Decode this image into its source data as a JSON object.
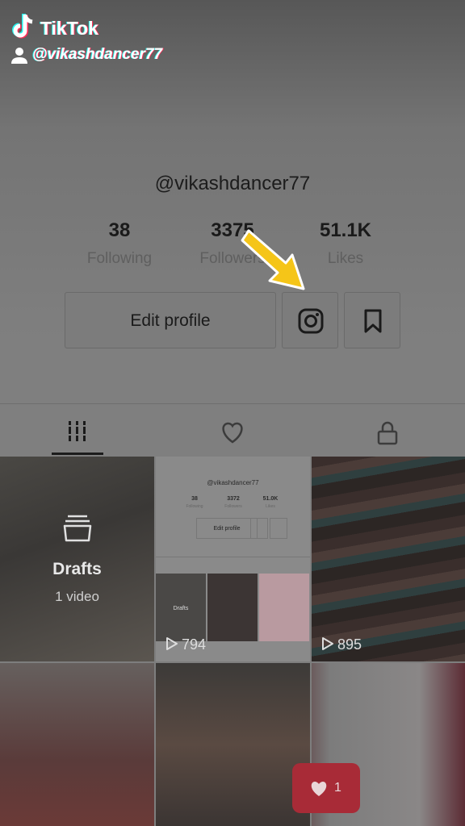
{
  "watermark": {
    "brand": "TikTok",
    "user": "@vikashdancer77"
  },
  "profile": {
    "username": "@vikashdancer77"
  },
  "stats": [
    {
      "value": "38",
      "label": "Following"
    },
    {
      "value": "3375",
      "label": "Followers"
    },
    {
      "value": "51.1K",
      "label": "Likes"
    }
  ],
  "actions": {
    "edit_profile": "Edit profile"
  },
  "tabs": [
    "videos-icon",
    "liked-icon",
    "private-icon"
  ],
  "grid": {
    "drafts": {
      "label": "Drafts",
      "count": "1 video"
    },
    "cell2_views": "794",
    "cell3_views": "895",
    "mini_profile": {
      "username": "@vikashdancer77",
      "stats": [
        {
          "value": "38",
          "label": "Following"
        },
        {
          "value": "3372",
          "label": "Followers"
        },
        {
          "value": "51.0K",
          "label": "Likes"
        }
      ],
      "edit": "Edit profile",
      "drafts": "Drafts"
    }
  },
  "like_popup": {
    "count": "1"
  },
  "colors": {
    "accent_red": "#a82b37",
    "arrow_yellow": "#f5c518"
  }
}
